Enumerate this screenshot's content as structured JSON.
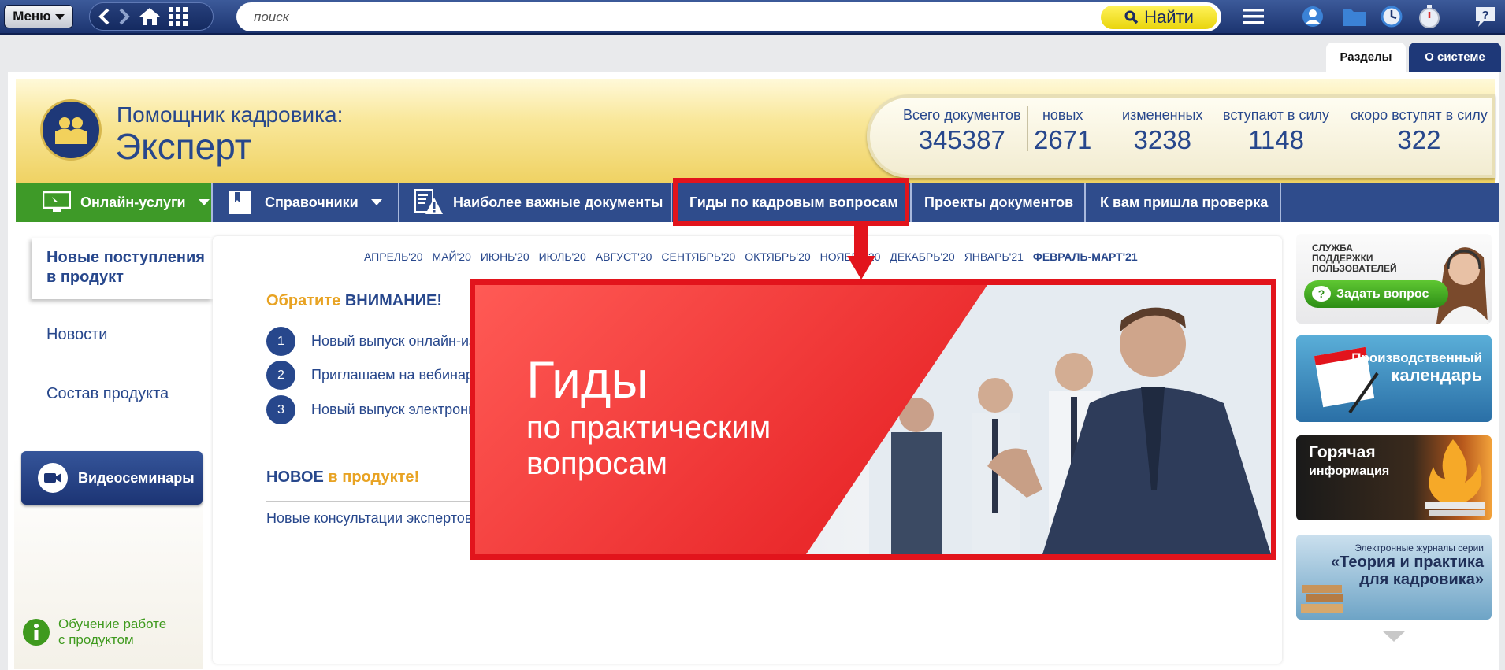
{
  "toolbar": {
    "menu_label": "Меню",
    "search_placeholder": "поиск",
    "find_label": "Найти"
  },
  "tabs": {
    "razdely": "Разделы",
    "o_sisteme": "О системе"
  },
  "header": {
    "logo_line1": "Помощник кадровика:",
    "logo_line2": "Эксперт",
    "stats": [
      {
        "label": "Всего документов",
        "value": "345387"
      },
      {
        "label": "новых",
        "value": "2671"
      },
      {
        "label": "измененных",
        "value": "3238"
      },
      {
        "label": "вступают в силу",
        "value": "1148"
      },
      {
        "label": "скоро вступят в силу",
        "value": "322"
      }
    ]
  },
  "nav": {
    "items": [
      {
        "label": "Онлайн-услуги"
      },
      {
        "label": "Справочники"
      },
      {
        "label": "Наиболее важные документы"
      },
      {
        "label": "Гиды по кадровым вопросам"
      },
      {
        "label": "Проекты документов"
      },
      {
        "label": "К вам пришла проверка"
      }
    ]
  },
  "sidebar": {
    "active": "Новые поступления в продукт",
    "items": [
      "Новости",
      "Состав продукта"
    ],
    "video_label": "Видеосеминары",
    "learn_label1": "Обучение работе",
    "learn_label2": "с продуктом"
  },
  "main": {
    "months": [
      "АПРЕЛЬ'20",
      "МАЙ'20",
      "ИЮНЬ'20",
      "ИЮЛЬ'20",
      "АВГУСТ'20",
      "СЕНТЯБРЬ'20",
      "ОКТЯБРЬ'20",
      "НОЯБРЬ'20",
      "ДЕКАБРЬ'20",
      "ЯНВАРЬ'21",
      "ФЕВРАЛЬ-МАРТ'21"
    ],
    "attention_a": "Обратите ",
    "attention_b": "ВНИМАНИЕ!",
    "list": [
      {
        "num": "1",
        "text": "Новый выпуск онлайн-из"
      },
      {
        "num": "2",
        "text": "Приглашаем на вебинар"
      },
      {
        "num": "3",
        "text": "Новый выпуск электронн"
      }
    ],
    "new_a": "НОВОЕ ",
    "new_b": "в продукте!",
    "consult": "Новые консультации экспертов"
  },
  "banner": {
    "title": "Гиды",
    "sub1": "по практическим",
    "sub2": "вопросам"
  },
  "right": {
    "support1": "СЛУЖБА",
    "support2": "ПОДДЕРЖКИ",
    "support3": "ПОЛЬЗОВАТЕЛЕЙ",
    "ask_label": "Задать вопрос",
    "cal1": "Производственный",
    "cal2": "календарь",
    "hot1": "Горячая",
    "hot2": "информация",
    "journ1": "Электронные журналы серии",
    "journ2": "«Теория и практика для кадровика»"
  },
  "colors": {
    "accent_red": "#e2141c",
    "navy": "#27478c",
    "green": "#3f9a1e",
    "yellow": "#f9e79a"
  }
}
